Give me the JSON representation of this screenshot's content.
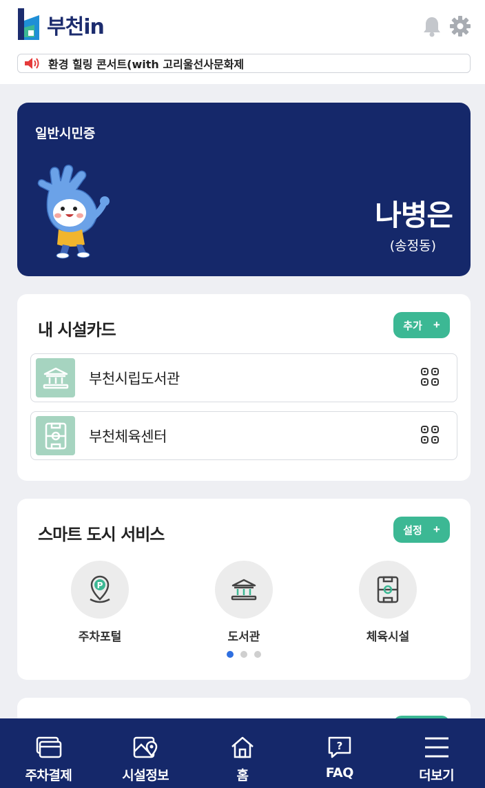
{
  "header": {
    "app_name": "부천in",
    "notice": "환경 힐링 콘서트(with 고리울선사문화제"
  },
  "id_card": {
    "label": "일반시민증",
    "name": "나병은",
    "dong": "(송정동)"
  },
  "facility_cards": {
    "title": "내 시설카드",
    "add_label": "추가",
    "items": [
      {
        "label": "부천시립도서관",
        "icon": "library-icon"
      },
      {
        "label": "부천체육센터",
        "icon": "sports-field-icon"
      }
    ]
  },
  "smart_city": {
    "title": "스마트 도시 서비스",
    "settings_label": "설정",
    "services": [
      {
        "label": "주차포털",
        "icon": "parking-pin-icon"
      },
      {
        "label": "도서관",
        "icon": "library-icon"
      },
      {
        "label": "체육시설",
        "icon": "sports-field-icon"
      }
    ],
    "page_count": 3,
    "active_page": 1
  },
  "bottom_nav": {
    "items": [
      {
        "label": "주차결제",
        "icon": "card-payment-icon"
      },
      {
        "label": "시설정보",
        "icon": "map-pin-icon"
      },
      {
        "label": "홈",
        "icon": "home-icon"
      },
      {
        "label": "FAQ",
        "icon": "question-chat-icon"
      },
      {
        "label": "더보기",
        "icon": "menu-icon"
      }
    ]
  },
  "colors": {
    "navy": "#15286a",
    "green": "#3cb894",
    "facility_icon_bg": "#a6d4c0"
  }
}
